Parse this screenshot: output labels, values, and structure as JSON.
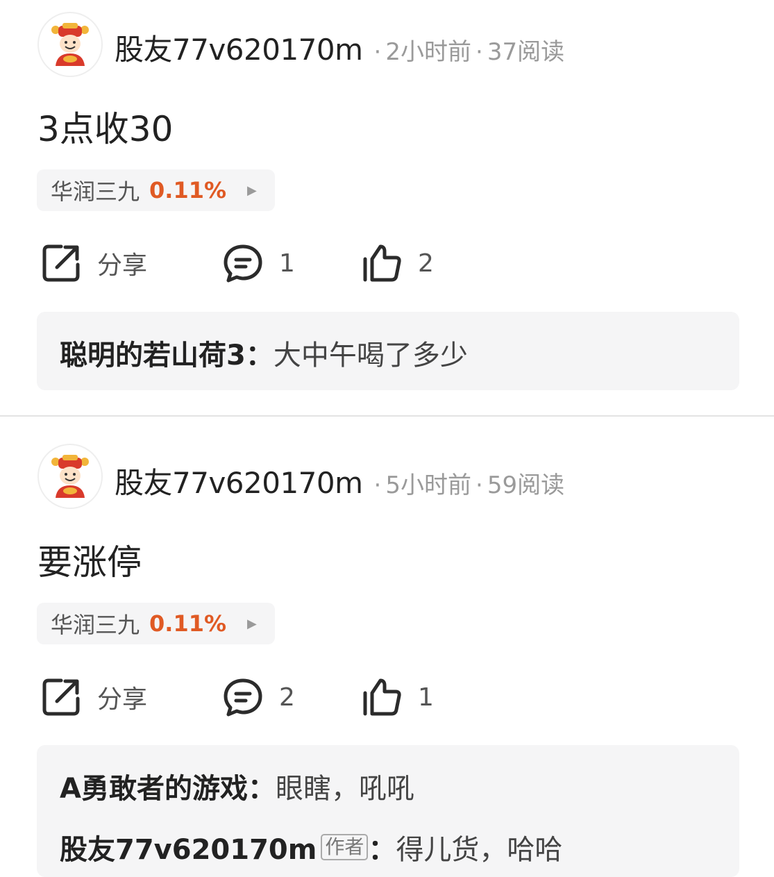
{
  "posts": [
    {
      "username": "股友77v620170m",
      "time": "2小时前",
      "reads": "37阅读",
      "content": "3点收30",
      "stock": {
        "name": "华润三九",
        "change": "0.11%"
      },
      "actions": {
        "share": "分享",
        "comments": "1",
        "likes": "2"
      },
      "comments": [
        {
          "name": "聪明的若山荷3：",
          "text": "大中午喝了多少"
        }
      ]
    },
    {
      "username": "股友77v620170m",
      "time": "5小时前",
      "reads": "59阅读",
      "content": "要涨停",
      "stock": {
        "name": "华润三九",
        "change": "0.11%"
      },
      "actions": {
        "share": "分享",
        "comments": "2",
        "likes": "1"
      },
      "comments": [
        {
          "name": "A勇敢者的游戏：",
          "text": "眼瞎，吼吼"
        },
        {
          "name": "股友77v620170m",
          "tag": "作者",
          "sep": "：",
          "text": "得儿货，哈哈"
        }
      ]
    }
  ],
  "colors": {
    "accent": "#e05a24",
    "muted": "#9a9a9a",
    "chip_bg": "#f5f5f6"
  },
  "meta_separator": "·"
}
